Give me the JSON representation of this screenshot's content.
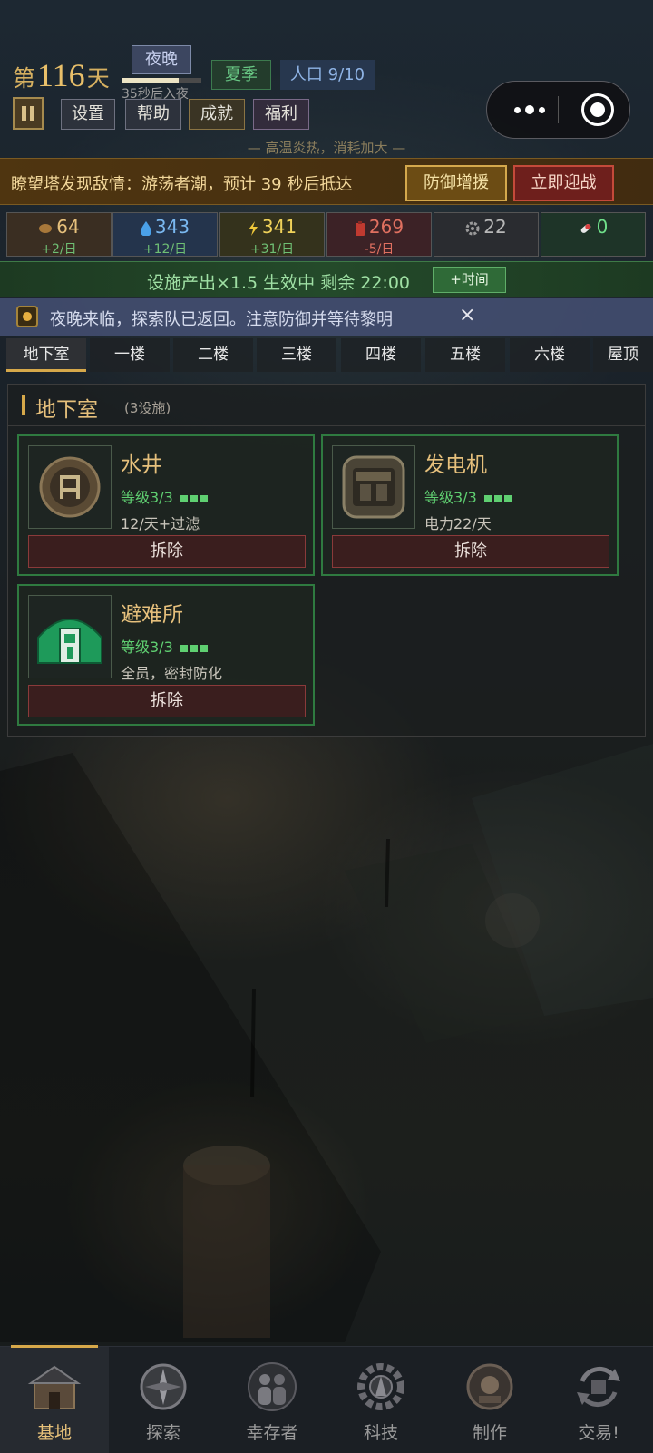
{
  "status": {
    "day_prefix": "第",
    "day_number": "116",
    "day_suffix": "天",
    "phase": "夜晚",
    "phase_countdown": "35秒后入夜",
    "phase_progress": 0.72,
    "season": "夏季",
    "population": "人口 9/10",
    "weather_note": "— 高温炎热，消耗加大 —"
  },
  "toolbar": {
    "settings": "设置",
    "help": "帮助",
    "achievements": "成就",
    "welfare": "福利"
  },
  "alert": {
    "message": "瞭望塔发现敌情：游荡者潮，预计 39 秒后抵达",
    "defend_button": "防御增援",
    "fight_button": "立即迎战"
  },
  "resources": [
    {
      "icon": "food-icon",
      "value": "64",
      "rate": "+2/日",
      "value_color": "#e6c07c",
      "rate_color": "#6fbf74"
    },
    {
      "icon": "water-icon",
      "value": "343",
      "rate": "+12/日",
      "value_color": "#7ab8f0",
      "rate_color": "#6fbf74"
    },
    {
      "icon": "power-icon",
      "value": "341",
      "rate": "+31/日",
      "value_color": "#f0d25a",
      "rate_color": "#6fbf74"
    },
    {
      "icon": "fuel-icon",
      "value": "269",
      "rate": "-5/日",
      "value_color": "#e07060",
      "rate_color": "#e07060"
    },
    {
      "icon": "parts-icon",
      "value": "22",
      "rate": "",
      "value_color": "#b8b8b8",
      "rate_color": "#6fbf74"
    },
    {
      "icon": "medicine-icon",
      "value": "0",
      "rate": "",
      "value_color": "#6fe08a",
      "rate_color": "#6fbf74"
    }
  ],
  "boost": {
    "text": "设施产出×1.5 生效中  剩余 22:00",
    "time_button": "+时间"
  },
  "notice": {
    "message": "夜晚来临，探索队已返回。注意防御并等待黎明",
    "close": "×"
  },
  "floor_tabs": [
    "地下室",
    "一楼",
    "二楼",
    "三楼",
    "四楼",
    "五楼",
    "六楼",
    "屋顶"
  ],
  "panel": {
    "title": "地下室",
    "count": "(3设施)"
  },
  "facilities": [
    {
      "name": "水井",
      "level": "等级3/3",
      "desc": "12/天+过滤",
      "demolish": "拆除",
      "icon": "well-icon"
    },
    {
      "name": "发电机",
      "level": "等级3/3",
      "desc": "电力22/天",
      "demolish": "拆除",
      "icon": "generator-icon"
    },
    {
      "name": "避难所",
      "level": "等级3/3",
      "desc": "全员，密封防化",
      "demolish": "拆除",
      "icon": "shelter-icon"
    }
  ],
  "nav": [
    {
      "label": "基地",
      "icon": "base-icon"
    },
    {
      "label": "探索",
      "icon": "compass-icon"
    },
    {
      "label": "幸存者",
      "icon": "survivors-icon"
    },
    {
      "label": "科技",
      "icon": "tech-icon"
    },
    {
      "label": "制作",
      "icon": "craft-icon"
    },
    {
      "label": "交易!",
      "icon": "trade-icon"
    }
  ],
  "colors": {
    "accent_gold": "#d6a84a",
    "alert_bg": "#4f3510",
    "boost_green": "#244a2a",
    "card_border": "#2f7a40"
  }
}
